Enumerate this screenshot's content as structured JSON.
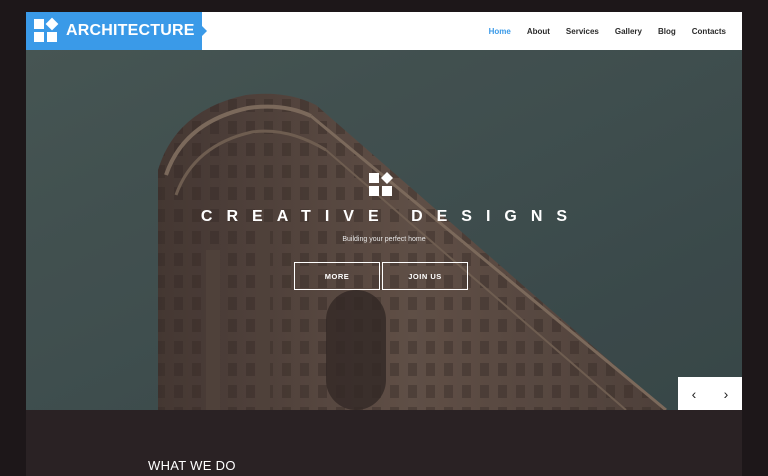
{
  "brand": {
    "name": "ARCHITECTURE",
    "accent": "#3a9ae8"
  },
  "nav": {
    "items": [
      {
        "label": "Home",
        "active": true
      },
      {
        "label": "About",
        "active": false
      },
      {
        "label": "Services",
        "active": false
      },
      {
        "label": "Gallery",
        "active": false
      },
      {
        "label": "Blog",
        "active": false
      },
      {
        "label": "Contacts",
        "active": false
      }
    ]
  },
  "hero": {
    "title": "CREATIVE DESIGNS",
    "subtitle": "Building your perfect home",
    "buttons": {
      "more": "MORE",
      "join": "JOIN US"
    },
    "icon": "logo-icon"
  },
  "slider": {
    "prev_icon": "chevron-left-icon",
    "next_icon": "chevron-right-icon",
    "prev": "‹",
    "next": "›"
  },
  "section": {
    "title": "WHAT WE DO"
  }
}
